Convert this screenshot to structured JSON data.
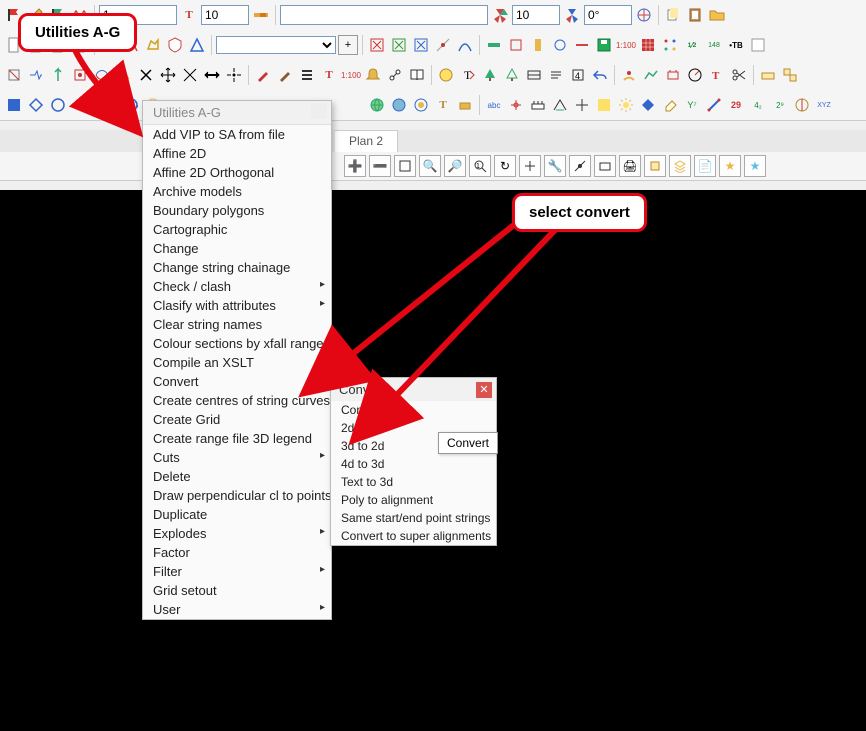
{
  "toolbar": {
    "row1": {
      "input1": "1",
      "input2": "10",
      "input3": "",
      "input4": "10",
      "input5": "0°"
    },
    "row2": {
      "combo1": ""
    }
  },
  "tabs": {
    "plan2": "Plan 2"
  },
  "callouts": {
    "utilities": "Utilities A-G",
    "select_convert": "select convert"
  },
  "menu": {
    "title": "Utilities A-G",
    "items": [
      {
        "label": "Add VIP to SA from file",
        "sub": false
      },
      {
        "label": "Affine 2D",
        "sub": false
      },
      {
        "label": "Affine 2D Orthogonal",
        "sub": false
      },
      {
        "label": "Archive models",
        "sub": false
      },
      {
        "label": "Boundary polygons",
        "sub": false
      },
      {
        "label": "Cartographic",
        "sub": false
      },
      {
        "label": "Change",
        "sub": false
      },
      {
        "label": "Change string chainage",
        "sub": false
      },
      {
        "label": "Check / clash",
        "sub": true
      },
      {
        "label": "Clasify with attributes",
        "sub": true
      },
      {
        "label": "Clear string names",
        "sub": false
      },
      {
        "label": "Colour sections by xfall range",
        "sub": false
      },
      {
        "label": "Compile an XSLT",
        "sub": false
      },
      {
        "label": "Convert",
        "sub": true
      },
      {
        "label": "Create centres of string curves",
        "sub": false
      },
      {
        "label": "Create Grid",
        "sub": false
      },
      {
        "label": "Create range file 3D legend",
        "sub": false
      },
      {
        "label": "Cuts",
        "sub": true
      },
      {
        "label": "Delete",
        "sub": false
      },
      {
        "label": "Draw perpendicular cl to points",
        "sub": false
      },
      {
        "label": "Duplicate",
        "sub": false
      },
      {
        "label": "Explodes",
        "sub": true
      },
      {
        "label": "Factor",
        "sub": false
      },
      {
        "label": "Filter",
        "sub": true
      },
      {
        "label": "Grid setout",
        "sub": false
      },
      {
        "label": "User",
        "sub": true
      }
    ]
  },
  "submenu": {
    "title": "Convert",
    "items": [
      "Convert",
      "2d to 3d",
      "3d to 2d",
      "4d to 3d",
      "Text to 3d",
      "Poly to alignment",
      "Same start/end point strings",
      "Convert to super alignments"
    ]
  },
  "tooltip": "Convert"
}
